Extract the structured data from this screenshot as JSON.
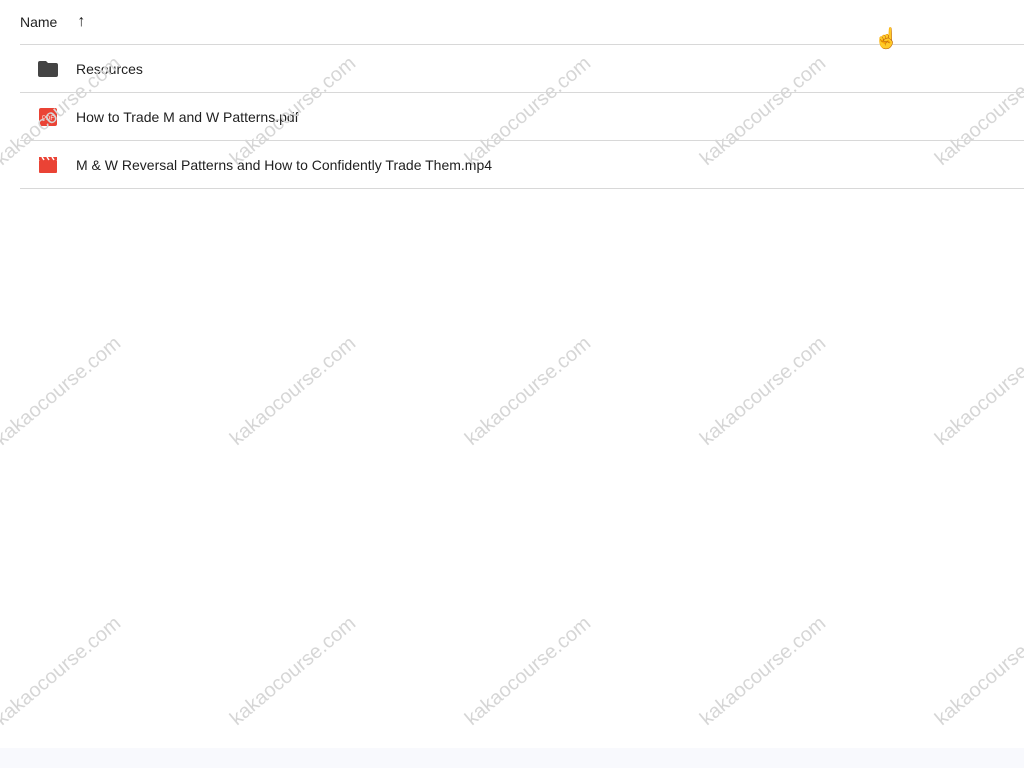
{
  "header": {
    "name_label": "Name"
  },
  "files": [
    {
      "name": "Resources",
      "type": "folder"
    },
    {
      "name": "How to Trade M and W Patterns.pdf",
      "type": "pdf",
      "badge": "PDF"
    },
    {
      "name": "M & W Reversal Patterns and How to Confidently Trade Them.mp4",
      "type": "video"
    }
  ],
  "watermark": "kakaocourse.com"
}
